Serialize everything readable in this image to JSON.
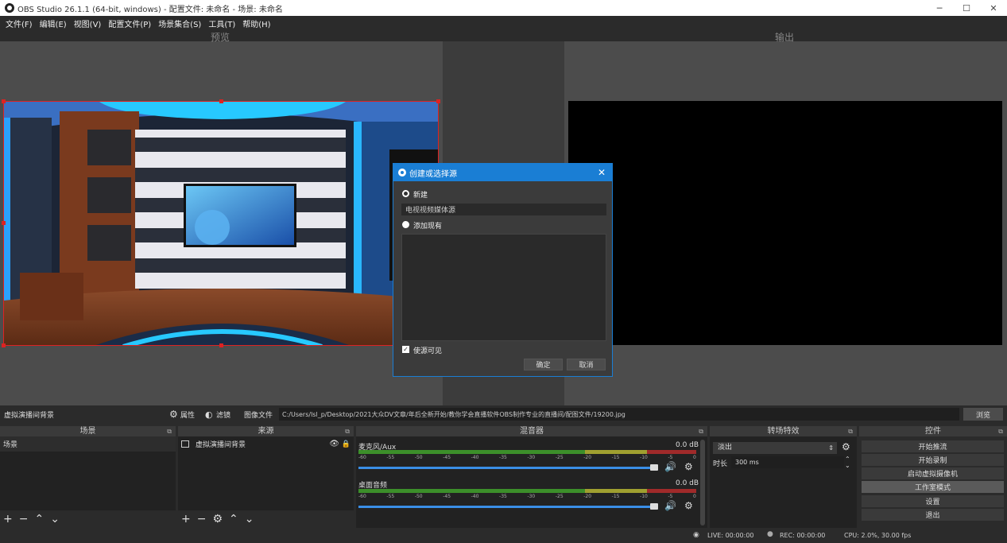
{
  "window": {
    "title": "OBS Studio 26.1.1 (64-bit, windows) - 配置文件: 未命名 - 场景: 未命名"
  },
  "menu": [
    "文件(F)",
    "编辑(E)",
    "视图(V)",
    "配置文件(P)",
    "场景集合(S)",
    "工具(T)",
    "帮助(H)"
  ],
  "preview_label": "预览",
  "output_label": "输出",
  "dialog": {
    "title": "创建或选择源",
    "new_label": "新建",
    "name_value": "电视视频媒体源",
    "add_existing_label": "添加现有",
    "visible_label": "使源可见",
    "ok_label": "确定",
    "cancel_label": "取消"
  },
  "source_bar": {
    "source_name": "虚拟演播间背景",
    "properties_label": "属性",
    "filters_label": "滤镜",
    "image_file_label": "图像文件",
    "path_value": "C:/Users/lsl_p/Desktop/2021大众DV文章/年后全新开始/教你学会直播软件OBS制作专业的直播间/配图文件/19200.jpg",
    "browse_label": "浏览"
  },
  "scenes": {
    "header": "场景",
    "items": [
      "场景"
    ]
  },
  "sources": {
    "header": "来源",
    "items": [
      "虚拟演播间背景"
    ]
  },
  "mixer": {
    "header": "混音器",
    "channels": [
      {
        "name": "麦克风/Aux",
        "db": "0.0 dB"
      },
      {
        "name": "桌面音频",
        "db": "0.0 dB"
      }
    ],
    "ticks": [
      "-60",
      "-55",
      "-50",
      "-45",
      "-40",
      "-35",
      "-30",
      "-25",
      "-20",
      "-15",
      "-10",
      "-5",
      "0"
    ]
  },
  "transitions": {
    "header": "转场特效",
    "selected": "淡出",
    "duration_label": "时长",
    "duration_value": "300 ms"
  },
  "controls": {
    "header": "控件",
    "buttons": [
      "开始推流",
      "开始录制",
      "启动虚拟摄像机",
      "工作室模式",
      "设置",
      "退出"
    ]
  },
  "status": {
    "live": "LIVE: 00:00:00",
    "rec": "REC: 00:00:00",
    "cpu": "CPU: 2.0%, 30.00 fps"
  },
  "colors": {
    "accent": "#1a7ed4",
    "selection": "#dd2222"
  }
}
